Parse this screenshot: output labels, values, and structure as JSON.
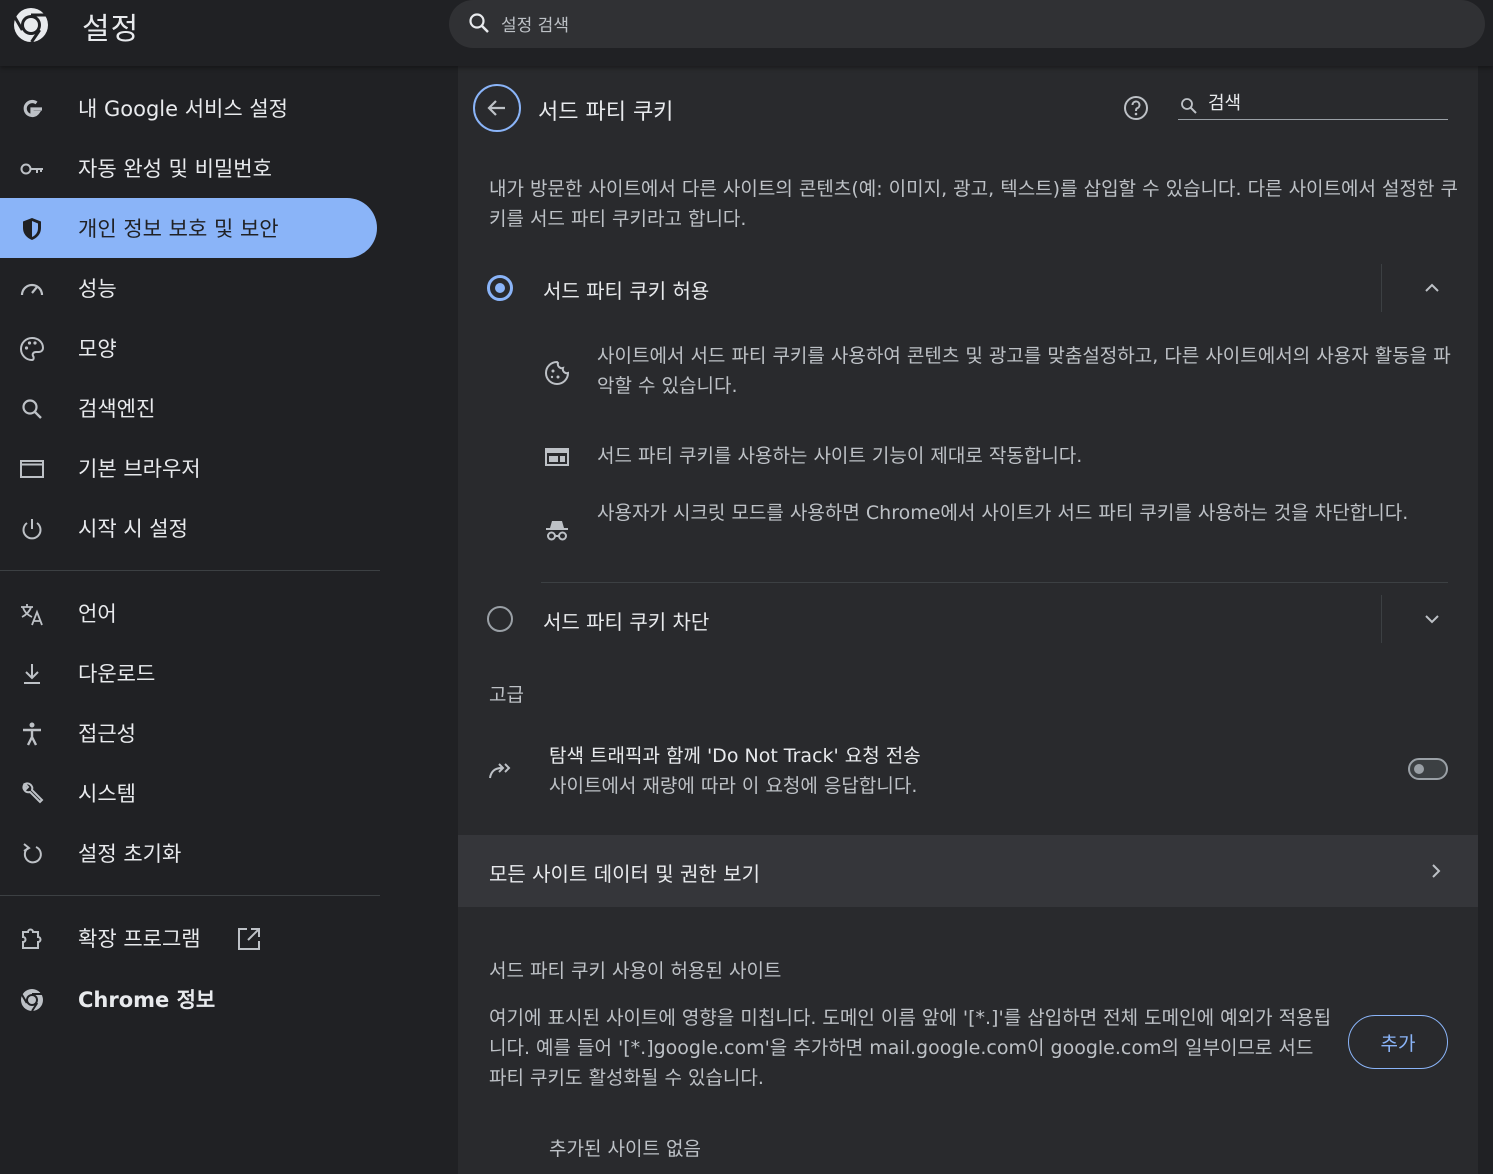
{
  "header": {
    "app_title": "설정",
    "search_placeholder": "설정 검색"
  },
  "sidebar": {
    "items": [
      {
        "label": "내 Google 서비스 설정",
        "icon": "google-icon"
      },
      {
        "label": "자동 완성 및 비밀번호",
        "icon": "key-icon"
      },
      {
        "label": "개인 정보 보호 및 보안",
        "icon": "shield-icon",
        "active": true
      },
      {
        "label": "성능",
        "icon": "speedometer-icon"
      },
      {
        "label": "모양",
        "icon": "palette-icon"
      },
      {
        "label": "검색엔진",
        "icon": "search-icon"
      },
      {
        "label": "기본 브라우저",
        "icon": "browser-window-icon"
      },
      {
        "label": "시작 시 설정",
        "icon": "power-icon"
      },
      {
        "label": "언어",
        "icon": "translate-icon"
      },
      {
        "label": "다운로드",
        "icon": "download-icon"
      },
      {
        "label": "접근성",
        "icon": "accessibility-icon"
      },
      {
        "label": "시스템",
        "icon": "wrench-icon"
      },
      {
        "label": "설정 초기화",
        "icon": "reset-icon"
      },
      {
        "label": "확장 프로그램",
        "icon": "puzzle-icon"
      },
      {
        "label": "Chrome 정보",
        "icon": "chrome-icon"
      }
    ]
  },
  "main": {
    "title": "서드 파티 쿠키",
    "search_placeholder": "검색",
    "description": "내가 방문한 사이트에서 다른 사이트의 콘텐츠(예: 이미지, 광고, 텍스트)를 삽입할 수 있습니다. 다른 사이트에서 설정한 쿠키를 서드 파티 쿠키라고 합니다.",
    "options": [
      {
        "label": "서드 파티 쿠키 허용",
        "selected": true,
        "expanded": true
      },
      {
        "label": "서드 파티 쿠키 차단",
        "selected": false,
        "expanded": false
      }
    ],
    "allow_details": [
      {
        "icon": "cookie-icon",
        "text": "사이트에서 서드 파티 쿠키를 사용하여 콘텐츠 및 광고를 맞춤설정하고, 다른 사이트에서의 사용자 활동을 파악할 수 있습니다."
      },
      {
        "icon": "web-feature-icon",
        "text": "서드 파티 쿠키를 사용하는 사이트 기능이 제대로 작동합니다."
      },
      {
        "icon": "incognito-icon",
        "text": "사용자가 시크릿 모드를 사용하면 Chrome에서 사이트가 서드 파티 쿠키를 사용하는 것을 차단합니다."
      }
    ],
    "advanced_label": "고급",
    "dnt": {
      "title": "탐색 트래픽과 함께 'Do Not Track' 요청 전송",
      "subtitle": "사이트에서 재량에 따라 이 요청에 응답합니다.",
      "enabled": false
    },
    "site_data_link": "모든 사이트 데이터 및 권한 보기",
    "allowed_sites": {
      "heading": "서드 파티 쿠키 사용이 허용된 사이트",
      "description": "여기에 표시된 사이트에 영향을 미칩니다. 도메인 이름 앞에 '[*.]'를 삽입하면 전체 도메인에 예외가 적용됩니다. 예를 들어 '[*.]google.com'을 추가하면 mail.google.com이 google.com의 일부이므로 서드 파티 쿠키도 활성화될 수 있습니다.",
      "add_button": "추가",
      "empty_text": "추가된 사이트 없음"
    }
  },
  "colors": {
    "accent": "#8ab4f8",
    "background": "#202124",
    "panel": "#292a2d"
  }
}
